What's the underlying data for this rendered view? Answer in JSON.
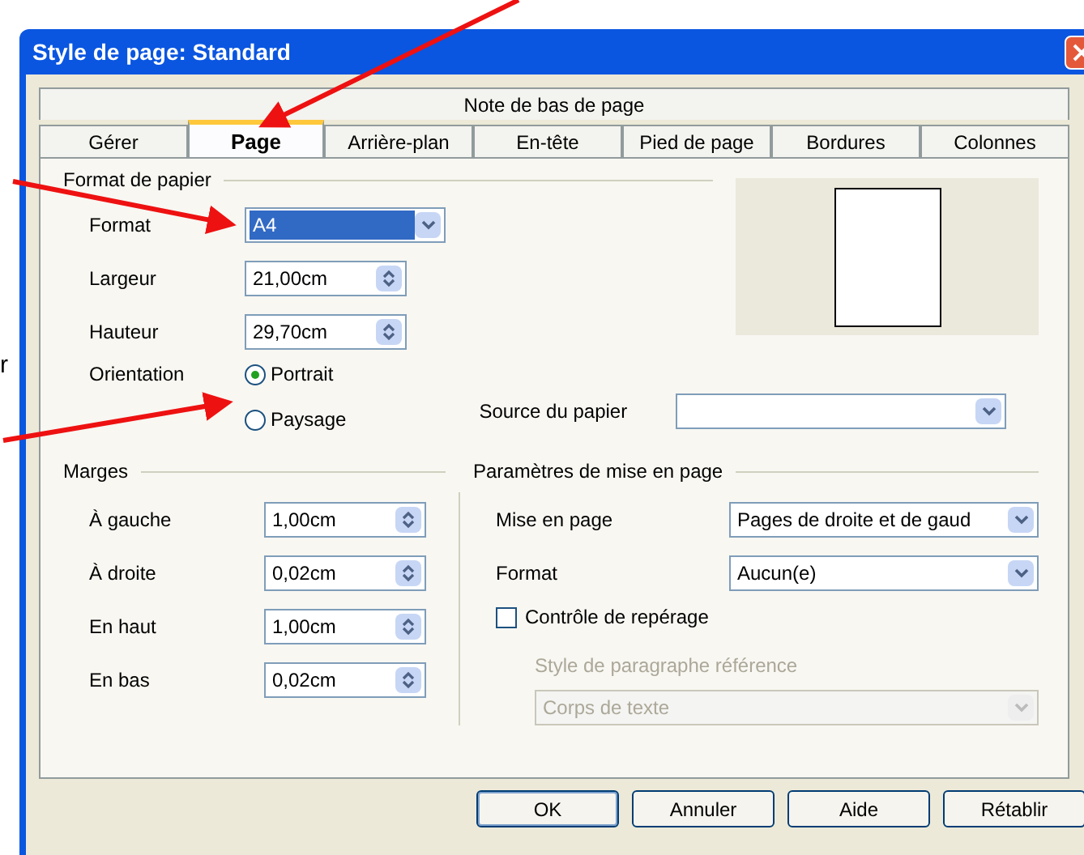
{
  "annotation_text": "r",
  "window": {
    "title": "Style de page: Standard"
  },
  "tabs_row_1": [
    {
      "label": "Note de bas de page",
      "selected": false
    }
  ],
  "tabs": [
    {
      "label": "Gérer",
      "selected": false
    },
    {
      "label": "Page",
      "selected": true
    },
    {
      "label": "Arrière-plan",
      "selected": false
    },
    {
      "label": "En-tête",
      "selected": false
    },
    {
      "label": "Pied de page",
      "selected": false
    },
    {
      "label": "Bordures",
      "selected": false
    },
    {
      "label": "Colonnes",
      "selected": false
    }
  ],
  "paper_format": {
    "title": "Format de papier",
    "format": {
      "label": "Format",
      "value": "A4"
    },
    "width": {
      "label": "Largeur",
      "value": "21,00cm"
    },
    "height": {
      "label": "Hauteur",
      "value": "29,70cm"
    },
    "orientation": {
      "label": "Orientation",
      "options": [
        {
          "label": "Portrait",
          "selected": true
        },
        {
          "label": "Paysage",
          "selected": false
        }
      ]
    },
    "paper_source": {
      "label": "Source du papier"
    }
  },
  "margins": {
    "title": "Marges",
    "fields": [
      {
        "label": "À gauche",
        "value": "1,00cm"
      },
      {
        "label": "À droite",
        "value": "0,02cm"
      },
      {
        "label": "En haut",
        "value": "1,00cm"
      },
      {
        "label": "En bas",
        "value": "0,02cm"
      }
    ]
  },
  "layout_settings": {
    "title": "Paramètres de mise en page",
    "page_layout": {
      "label": "Mise en page",
      "value": "Pages de droite et de gaud"
    },
    "format": {
      "label": "Format",
      "value": "Aucun(e)"
    },
    "register_true": {
      "label": "Contrôle de repérage",
      "checked": false
    },
    "reference_style": {
      "label": "Style de paragraphe référence",
      "value": "Corps de texte",
      "disabled": true
    }
  },
  "buttons": [
    {
      "label": "OK",
      "default": true
    },
    {
      "label": "Annuler",
      "default": false
    },
    {
      "label": "Aide",
      "default": false
    },
    {
      "label": "Rétablir",
      "default": false
    }
  ]
}
